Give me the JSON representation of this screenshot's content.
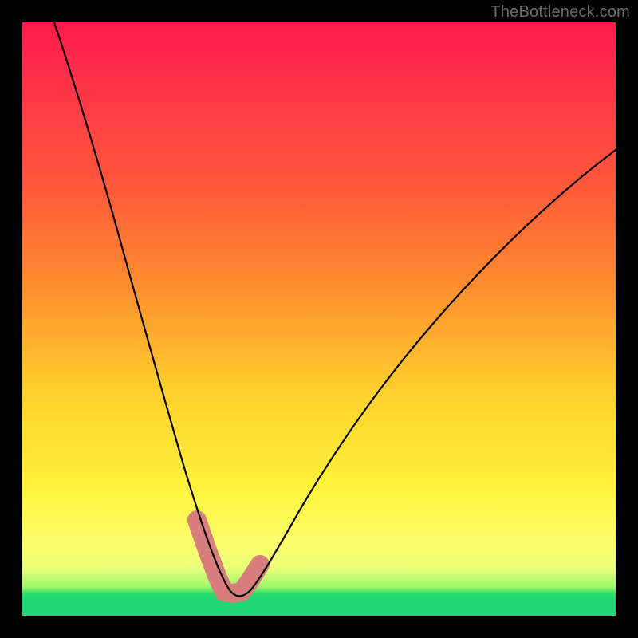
{
  "watermark": {
    "text": "TheBottleneck.com"
  },
  "chart_data": {
    "type": "line",
    "title": "",
    "xlabel": "",
    "ylabel": "",
    "xlim": [
      0,
      100
    ],
    "ylim": [
      0,
      100
    ],
    "grid": false,
    "legend": false,
    "background": {
      "kind": "vertical-gradient",
      "stops": [
        {
          "pos": 0.0,
          "color": "#ff1a4b"
        },
        {
          "pos": 0.28,
          "color": "#ff5a3a"
        },
        {
          "pos": 0.62,
          "color": "#ffcf2d"
        },
        {
          "pos": 0.88,
          "color": "#fcff6e"
        },
        {
          "pos": 0.96,
          "color": "#2fe06a"
        },
        {
          "pos": 1.0,
          "color": "#1fd873"
        }
      ]
    },
    "series": [
      {
        "name": "bottleneck-curve",
        "type": "line",
        "color": "#000000",
        "stroke_width": 2,
        "x": [
          0,
          4,
          8,
          12,
          16,
          20,
          24,
          28,
          30,
          32,
          34,
          36,
          38,
          40,
          44,
          50,
          56,
          62,
          70,
          80,
          90,
          100
        ],
        "y": [
          100,
          90,
          79,
          68,
          56,
          44,
          33,
          20,
          14,
          9,
          5,
          3,
          3,
          4,
          7,
          14,
          22,
          30,
          40,
          51,
          61,
          70
        ]
      },
      {
        "name": "bottom-highlight",
        "type": "line",
        "color": "#d87a7a",
        "stroke_width": 14,
        "linecap": "round",
        "x": [
          29.5,
          31.2,
          32.8,
          34.0,
          35.5,
          37.0,
          38.2,
          40.0
        ],
        "y": [
          13.0,
          8.0,
          4.5,
          3.0,
          3.0,
          3.2,
          4.5,
          7.0
        ]
      }
    ]
  }
}
